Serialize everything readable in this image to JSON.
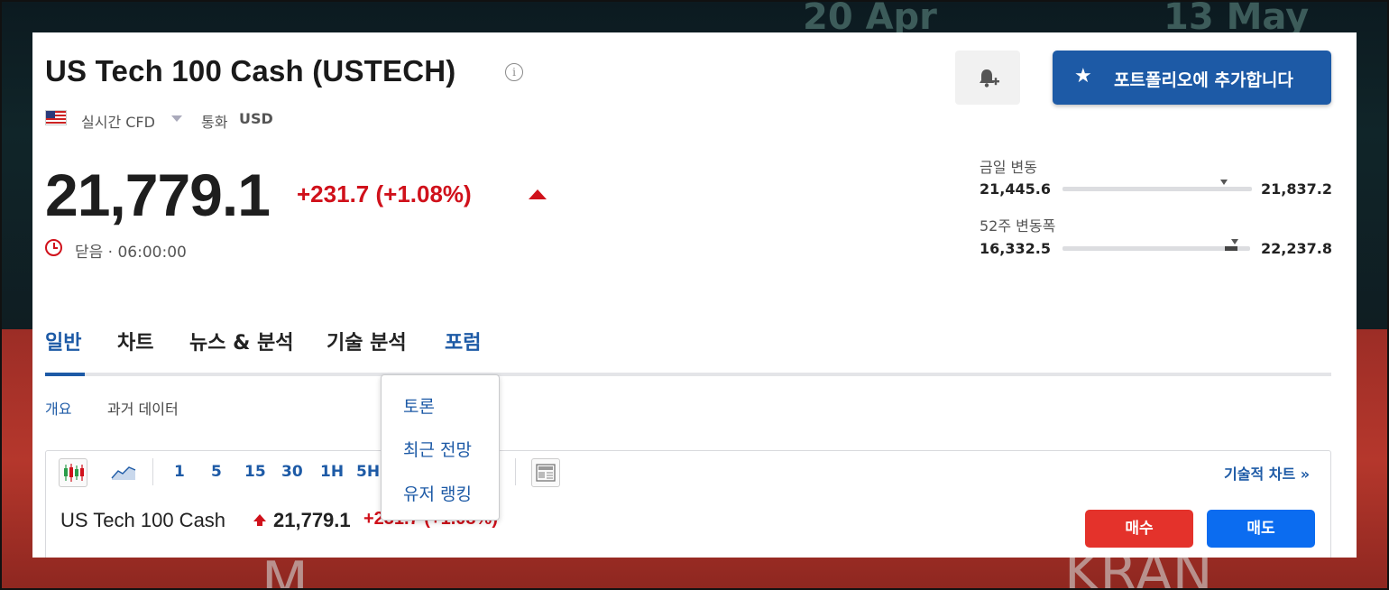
{
  "instrument": {
    "title": "US Tech 100 Cash (USTECH)",
    "info_icon": "i",
    "market_type": "실시간 CFD",
    "currency_label": "통화",
    "currency": "USD"
  },
  "header_actions": {
    "alert_icon": "bell-plus-icon",
    "add_portfolio_label": "포트폴리오에 추가합니다",
    "add_portfolio_icon": "star-icon"
  },
  "quote": {
    "price": "21,779.1",
    "change": "+231.7 (+1.08%)",
    "status": "닫음 · 06:00:00"
  },
  "ranges": {
    "day": {
      "label": "금일 변동",
      "low": "21,445.6",
      "high": "21,837.2",
      "position": 0.85
    },
    "week52": {
      "label": "52주 변동폭",
      "low": "16,332.5",
      "high": "22,237.8",
      "position": 0.92
    }
  },
  "tabs": [
    {
      "label": "일반"
    },
    {
      "label": "차트"
    },
    {
      "label": "뉴스 & 분석"
    },
    {
      "label": "기술 분석"
    },
    {
      "label": "포럼"
    }
  ],
  "subtabs": [
    {
      "label": "개요"
    },
    {
      "label": "과거 데이터"
    }
  ],
  "toolbar": {
    "intervals": [
      "1",
      "5",
      "15",
      "30",
      "1H",
      "5H"
    ],
    "tech_chart_link": "기술적 차트 »"
  },
  "quote_row": {
    "name": "US Tech 100 Cash",
    "price": "21,779.1",
    "change": "+231.7 (+1.08%)",
    "buy_label": "매수",
    "sell_label": "매도"
  },
  "forum_menu": {
    "items": [
      "토론",
      "최근 전망",
      "유저 랭킹"
    ]
  },
  "colors": {
    "accent": "#1d5aa6",
    "positive_red": "#d0111b",
    "buy": "#e4322b",
    "sell": "#0b6cf0"
  }
}
